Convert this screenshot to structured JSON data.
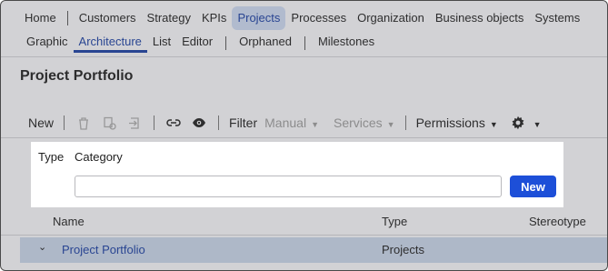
{
  "nav": {
    "primary": [
      "Home",
      "Customers",
      "Strategy",
      "KPIs",
      "Projects",
      "Processes",
      "Organization",
      "Business objects",
      "Systems"
    ],
    "active_primary": "Projects",
    "secondary": [
      "Graphic",
      "Architecture",
      "List",
      "Editor",
      "Orphaned",
      "Milestones"
    ],
    "active_secondary": "Architecture"
  },
  "page": {
    "title": "Project Portfolio"
  },
  "toolbar": {
    "new_label": "New",
    "filter_label": "Filter",
    "manual_label": "Manual",
    "services_label": "Services",
    "permissions_label": "Permissions",
    "icons": [
      "trash-icon",
      "copy-icon",
      "move-icon",
      "link-icon",
      "eye-icon",
      "gear-icon"
    ]
  },
  "filter_panel": {
    "type_label": "Type",
    "category_label": "Category",
    "input_value": "",
    "new_button": "New"
  },
  "table": {
    "columns": [
      "Name",
      "Type",
      "Stereotype"
    ],
    "rows": [
      {
        "name": "Project Portfolio",
        "type": "Projects",
        "stereotype": ""
      }
    ]
  },
  "colors": {
    "accent": "#1b3fa0",
    "primary_button": "#1d4fd8",
    "active_tab_bg": "#c9d6ee",
    "selected_row_bg": "#c6d2e6"
  }
}
